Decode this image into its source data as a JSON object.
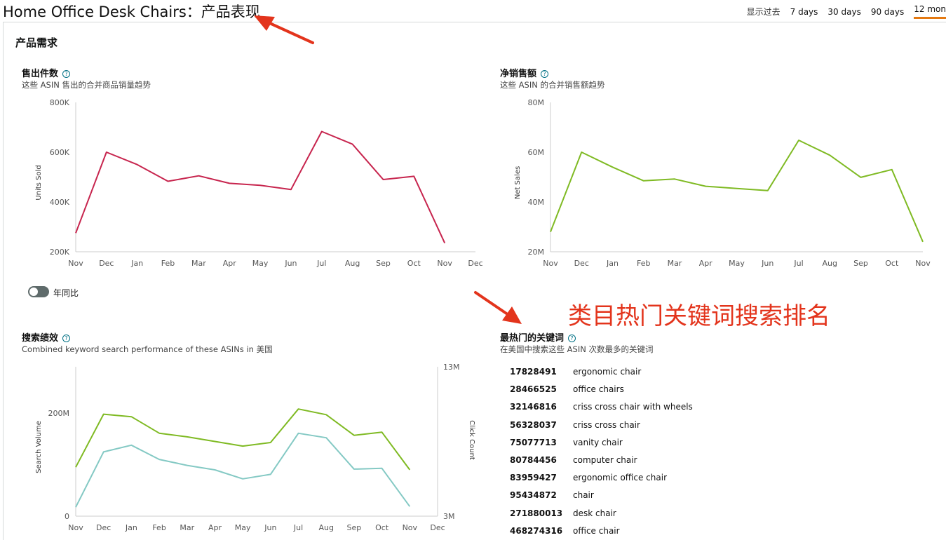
{
  "page": {
    "title": "Home Office Desk Chairs：产品表现",
    "range_label": "显示过去",
    "range_options": [
      "7 days",
      "30 days",
      "90 days",
      "12 mon"
    ],
    "active_range": "12 mon",
    "accent_color": "#e47911"
  },
  "section": {
    "heading": "产品需求"
  },
  "annotation": {
    "text": "类目热门关键词搜索排名",
    "color": "#e3341c"
  },
  "toggle": {
    "label": "年同比",
    "on": false
  },
  "help_glyph": "?",
  "charts": {
    "units": {
      "title": "售出件数",
      "subtitle": "这些 ASIN 售出的合并商品销量趋势"
    },
    "sales": {
      "title": "净销售额",
      "subtitle": "这些 ASIN 的合并销售额趋势"
    },
    "search": {
      "title": "搜索绩效",
      "subtitle": "Combined keyword search performance of these ASINs in 美国"
    }
  },
  "keywords": {
    "title": "最热门的关键词",
    "subtitle": "在美国中搜索这些 ASIN 次数最多的关键词",
    "rows": [
      {
        "rank": "17828491",
        "term": "ergonomic chair"
      },
      {
        "rank": "28466525",
        "term": "office chairs"
      },
      {
        "rank": "32146816",
        "term": "criss cross chair with wheels"
      },
      {
        "rank": "56328037",
        "term": "criss cross chair"
      },
      {
        "rank": "75077713",
        "term": "vanity chair"
      },
      {
        "rank": "80784456",
        "term": "computer chair"
      },
      {
        "rank": "83959427",
        "term": "ergonomic office chair"
      },
      {
        "rank": "95434872",
        "term": "chair"
      },
      {
        "rank": "271880013",
        "term": "desk chair"
      },
      {
        "rank": "468274316",
        "term": "office chair"
      }
    ]
  },
  "chart_data": [
    {
      "type": "line",
      "categories": [
        "Nov",
        "Dec",
        "Jan",
        "Feb",
        "Mar",
        "Apr",
        "May",
        "Jun",
        "Jul",
        "Aug",
        "Sep",
        "Oct",
        "Nov",
        "Dec"
      ],
      "series": [
        {
          "name": "",
          "color": "#c7254e",
          "values": [
            275000,
            600000,
            550000,
            483000,
            505000,
            475000,
            467000,
            450000,
            683000,
            632000,
            490000,
            503000,
            235000
          ]
        }
      ],
      "ylabel": "Units Sold",
      "ylim": [
        200000,
        800000
      ],
      "yticks": [
        200000,
        400000,
        600000,
        800000
      ],
      "ytick_labels": [
        "200K",
        "400K",
        "600K",
        "800K"
      ],
      "grid": false
    },
    {
      "type": "line",
      "categories": [
        "Nov",
        "Dec",
        "Jan",
        "Feb",
        "Mar",
        "Apr",
        "May",
        "Jun",
        "Jul",
        "Aug",
        "Sep",
        "Oct",
        "Nov"
      ],
      "series": [
        {
          "name": "",
          "color": "#7fba23",
          "values": [
            28000000,
            60000000,
            54000000,
            48500000,
            49200000,
            46300000,
            45400000,
            44600000,
            64800000,
            58800000,
            49900000,
            53000000,
            24000000
          ]
        }
      ],
      "ylabel": "Net Sales",
      "ylim": [
        20000000,
        80000000
      ],
      "yticks": [
        20000000,
        40000000,
        60000000,
        80000000
      ],
      "ytick_labels": [
        "20M",
        "40M",
        "60M",
        "80M"
      ],
      "grid": false
    },
    {
      "type": "line",
      "categories": [
        "Nov",
        "Dec",
        "Jan",
        "Feb",
        "Mar",
        "Apr",
        "May",
        "Jun",
        "Jul",
        "Aug",
        "Sep",
        "Oct",
        "Nov",
        "Dec"
      ],
      "series": [
        {
          "name": "",
          "axis": "left",
          "color": "#7fba23",
          "values": [
            95000000,
            198000000,
            193000000,
            161000000,
            154000000,
            145000000,
            136000000,
            143000000,
            208000000,
            197000000,
            157000000,
            163000000,
            90000000
          ]
        },
        {
          "name": "",
          "axis": "right",
          "color": "#84c9c4",
          "values": [
            3600000,
            7300000,
            7750000,
            6800000,
            6400000,
            6100000,
            5500000,
            5800000,
            8550000,
            8250000,
            6150000,
            6200000,
            3650000
          ]
        }
      ],
      "ylabel": "Search Volume",
      "ylim": [
        0,
        290000000
      ],
      "yticks": [
        0,
        200000000
      ],
      "ytick_labels": [
        "0",
        "200M"
      ],
      "y2label": "Click Count",
      "y2lim": [
        3000000,
        13000000
      ],
      "y2ticks": [
        3000000,
        13000000
      ],
      "y2tick_labels": [
        "3M",
        "13M"
      ],
      "grid": false
    }
  ]
}
